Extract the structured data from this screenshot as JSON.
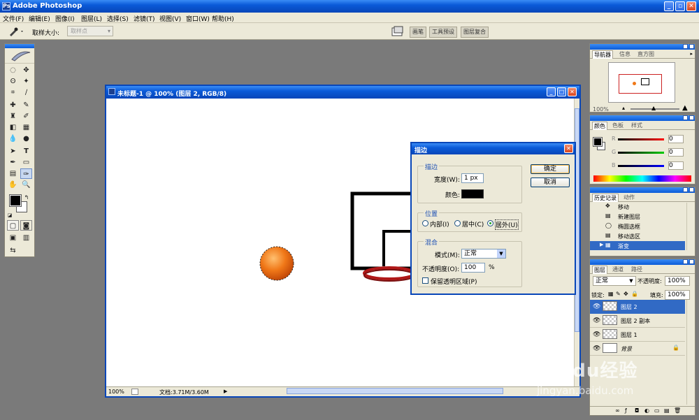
{
  "app": {
    "title": "Adobe Photoshop"
  },
  "menu": [
    "文件(F)",
    "编辑(E)",
    "图像(I)",
    "图层(L)",
    "选择(S)",
    "滤镜(T)",
    "视图(V)",
    "窗口(W)",
    "帮助(H)"
  ],
  "options_bar": {
    "sample_size_label": "取样大小:",
    "sample_size_value": "取样点",
    "well_tabs": [
      "画笔",
      "工具预设",
      "图层复合"
    ]
  },
  "document": {
    "title": "未标题-1 @ 100% (图层 2, RGB/8)",
    "zoom": "100%",
    "doc_size": "文档:3.71M/3.60M"
  },
  "stroke_dialog": {
    "title": "描边",
    "stroke_group": "描边",
    "width_label": "宽度(W):",
    "width_value": "1 px",
    "color_label": "颜色:",
    "color_value": "#000000",
    "location_group": "位置",
    "locations": [
      "内部(I)",
      "居中(C)",
      "居外(U)"
    ],
    "selected_location": "居外(U)",
    "blend_group": "混合",
    "mode_label": "模式(M):",
    "mode_value": "正常",
    "opacity_label": "不透明度(O):",
    "opacity_value": "100",
    "opacity_unit": "%",
    "preserve_label": "保留透明区域(P)",
    "preserve_checked": false,
    "ok_label": "确定",
    "cancel_label": "取消"
  },
  "navigator_panel": {
    "tabs": [
      "导航器",
      "信息",
      "直方图"
    ],
    "zoom": "100%"
  },
  "color_panel": {
    "tabs": [
      "颜色",
      "色板",
      "样式"
    ],
    "channels": [
      "R",
      "G",
      "B"
    ],
    "values": [
      "0",
      "0",
      "0"
    ]
  },
  "history_panel": {
    "tabs": [
      "历史记录",
      "动作"
    ],
    "items": [
      "移动",
      "新建图层",
      "椭圆选框",
      "移动选区",
      "渐变"
    ],
    "selected": "渐变"
  },
  "layers_panel": {
    "tabs": [
      "图层",
      "通道",
      "路径"
    ],
    "blend_mode": "正常",
    "opacity_label": "不透明度:",
    "opacity": "100%",
    "lock_label": "锁定:",
    "fill_label": "填充:",
    "fill": "100%",
    "layers": [
      "图层 2",
      "图层 2 副本",
      "图层 1",
      "背景"
    ],
    "selected": "图层 2"
  },
  "watermark": {
    "brand": "Baidu经验",
    "url": "jingyan.baidu.com"
  },
  "colors": {
    "titlebar": "#0a5ad8",
    "ball": "#f07818",
    "hoop_rim": "#b01818",
    "selection": "#316ac5"
  }
}
